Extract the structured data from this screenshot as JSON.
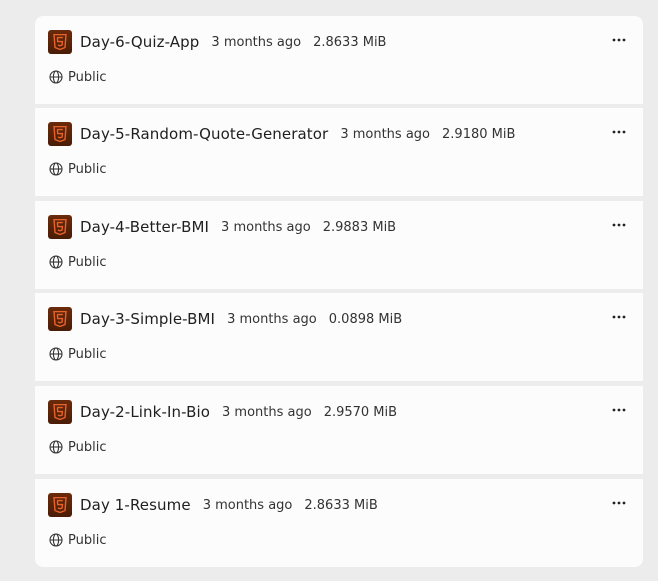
{
  "repos": [
    {
      "name": "Day-6-Quiz-App",
      "time": "3 months ago",
      "size": "2.8633 MiB",
      "visibility": "Public",
      "language_icon": "html5-icon"
    },
    {
      "name": "Day-5-Random-Quote-Generator",
      "time": "3 months ago",
      "size": "2.9180 MiB",
      "visibility": "Public",
      "language_icon": "html5-icon"
    },
    {
      "name": "Day-4-Better-BMI",
      "time": "3 months ago",
      "size": "2.9883 MiB",
      "visibility": "Public",
      "language_icon": "html5-icon"
    },
    {
      "name": "Day-3-Simple-BMI",
      "time": "3 months ago",
      "size": "0.0898 MiB",
      "visibility": "Public",
      "language_icon": "html5-icon"
    },
    {
      "name": "Day-2-Link-In-Bio",
      "time": "3 months ago",
      "size": "2.9570 MiB",
      "visibility": "Public",
      "language_icon": "html5-icon"
    },
    {
      "name": "Day 1-Resume",
      "time": "3 months ago",
      "size": "2.8633 MiB",
      "visibility": "Public",
      "language_icon": "html5-icon"
    }
  ],
  "colors": {
    "background": "#ececec",
    "card": "#fcfcfc",
    "icon_bg": "#5a2208",
    "html5_orange": "#e8632b"
  }
}
